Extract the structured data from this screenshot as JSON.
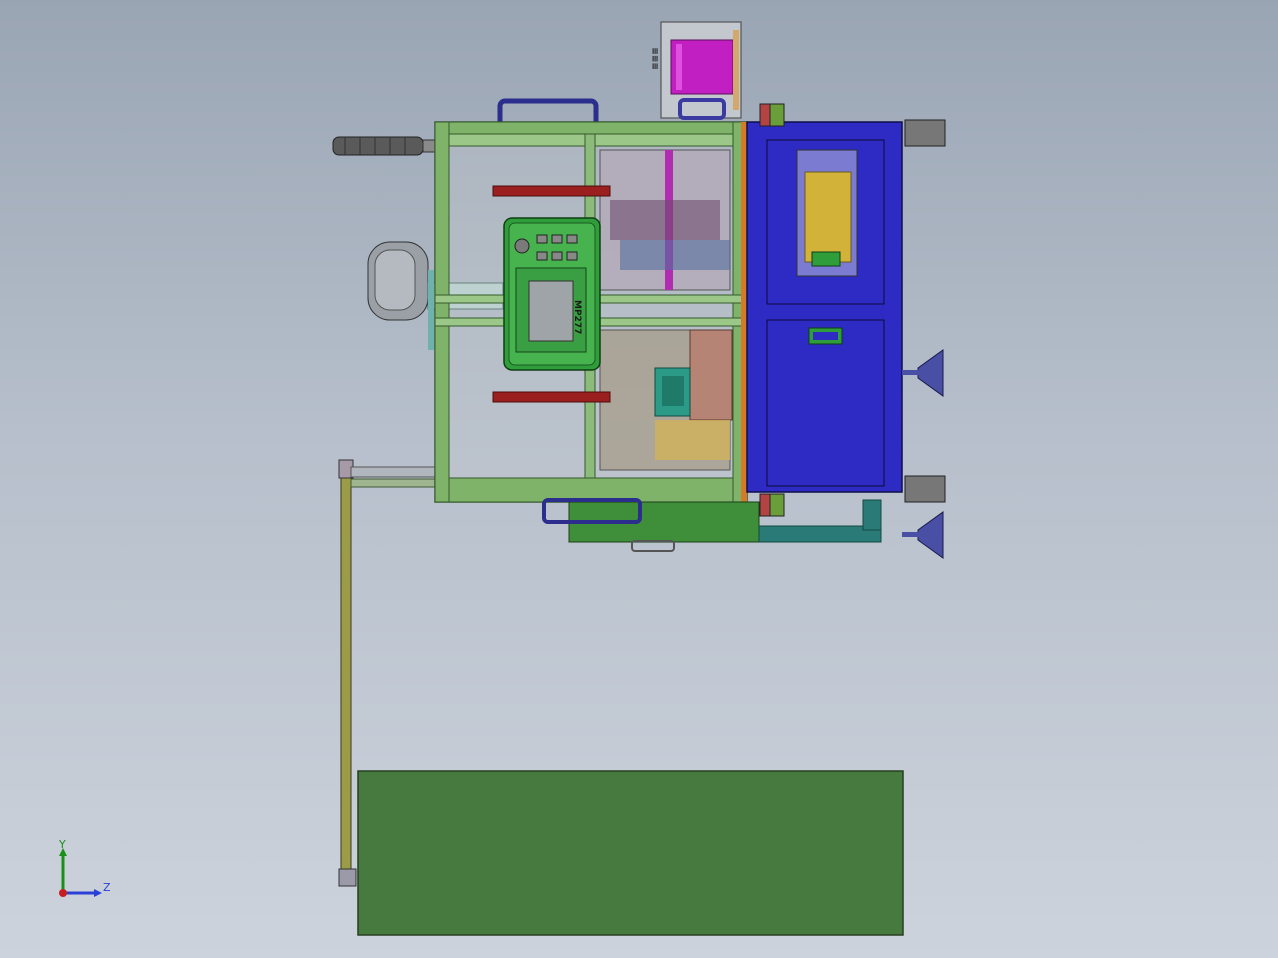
{
  "viewport": {
    "background_top": "#9aa5b4",
    "background_bottom": "#cdd3dc"
  },
  "model": {
    "hmi_label": "MP277",
    "parts": {
      "frame_color": "#7fb36a",
      "cabinet_color": "#2e2bc4",
      "base_plate_color": "#467a3e",
      "spool_color": "#c21fc2",
      "hmi_panel_color": "#2f9e3a",
      "mount_bar_color": "#9b1f1f",
      "foot_color": "#4a4fa6",
      "valve_color": "#d3b23a",
      "robot_arm_color": "#9aa0a6",
      "pipe_color": "#8b8b3a"
    }
  },
  "triad": {
    "y_label": "Y",
    "z_label": "Z",
    "y_color": "#1a8f1a",
    "z_color": "#2a3fd6",
    "x_color": "#c81e1e"
  }
}
